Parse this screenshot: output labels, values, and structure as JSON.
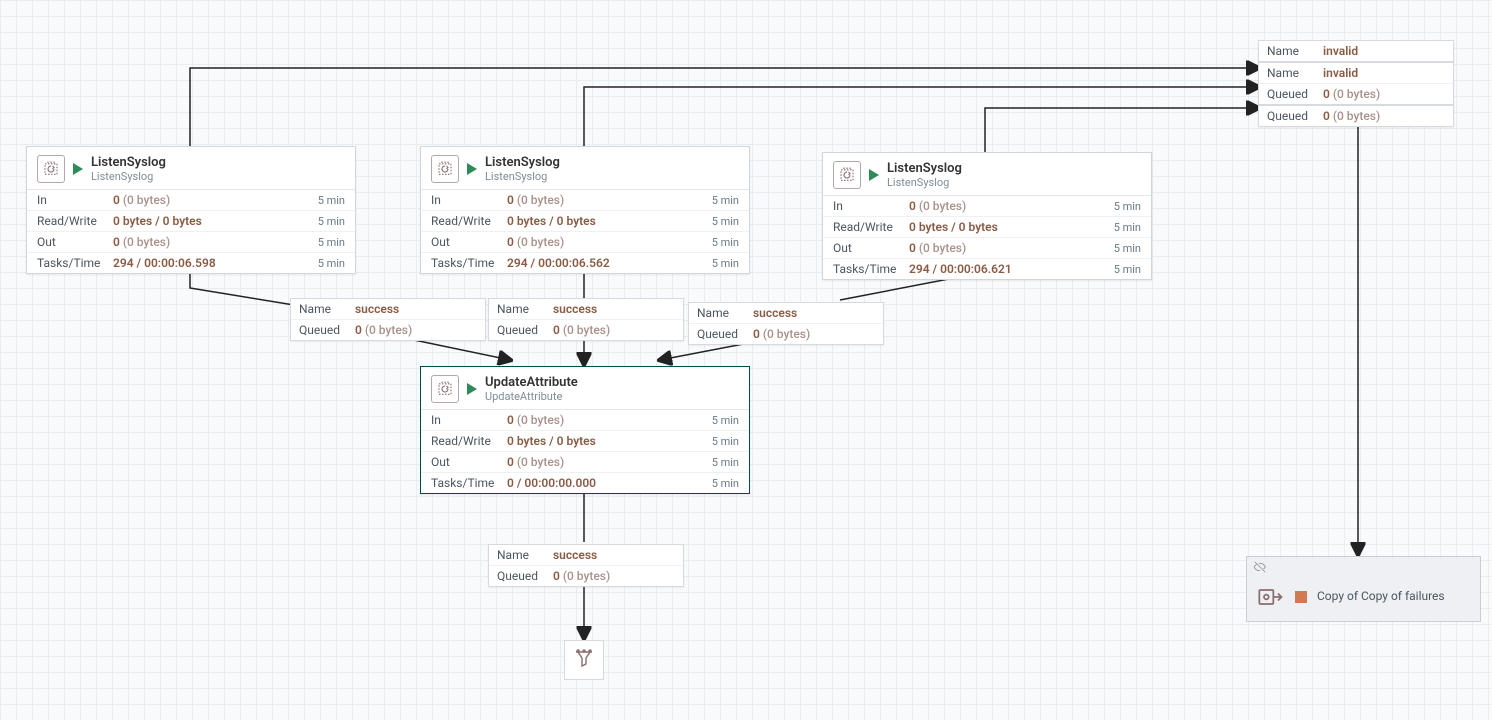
{
  "processors": [
    {
      "id": "p1",
      "title": "ListenSyslog",
      "subtitle": "ListenSyslog",
      "stats": {
        "in": {
          "count": "0",
          "bytes": "(0 bytes)",
          "time": "5 min"
        },
        "rw": {
          "value": "0 bytes / 0 bytes",
          "time": "5 min"
        },
        "out": {
          "count": "0",
          "bytes": "(0 bytes)",
          "time": "5 min"
        },
        "tasks": {
          "value": "294 / 00:00:06.598",
          "time": "5 min"
        }
      }
    },
    {
      "id": "p2",
      "title": "ListenSyslog",
      "subtitle": "ListenSyslog",
      "stats": {
        "in": {
          "count": "0",
          "bytes": "(0 bytes)",
          "time": "5 min"
        },
        "rw": {
          "value": "0 bytes / 0 bytes",
          "time": "5 min"
        },
        "out": {
          "count": "0",
          "bytes": "(0 bytes)",
          "time": "5 min"
        },
        "tasks": {
          "value": "294 / 00:00:06.562",
          "time": "5 min"
        }
      }
    },
    {
      "id": "p3",
      "title": "ListenSyslog",
      "subtitle": "ListenSyslog",
      "stats": {
        "in": {
          "count": "0",
          "bytes": "(0 bytes)",
          "time": "5 min"
        },
        "rw": {
          "value": "0 bytes / 0 bytes",
          "time": "5 min"
        },
        "out": {
          "count": "0",
          "bytes": "(0 bytes)",
          "time": "5 min"
        },
        "tasks": {
          "value": "294 / 00:00:06.621",
          "time": "5 min"
        }
      }
    },
    {
      "id": "p4",
      "title": "UpdateAttribute",
      "subtitle": "UpdateAttribute",
      "stats": {
        "in": {
          "count": "0",
          "bytes": "(0 bytes)",
          "time": "5 min"
        },
        "rw": {
          "value": "0 bytes / 0 bytes",
          "time": "5 min"
        },
        "out": {
          "count": "0",
          "bytes": "(0 bytes)",
          "time": "5 min"
        },
        "tasks": {
          "value": "0 / 00:00:00.000",
          "time": "5 min"
        }
      }
    }
  ],
  "labels": {
    "name": "Name",
    "queued": "Queued",
    "in": "In",
    "rw": "Read/Write",
    "out": "Out",
    "tasks": "Tasks/Time"
  },
  "connections": {
    "success": {
      "name": "success",
      "queued_count": "0",
      "queued_bytes": "(0 bytes)"
    },
    "invalid": {
      "name": "invalid",
      "queued_count": "0",
      "queued_bytes": "(0 bytes)"
    }
  },
  "group": {
    "title": "Copy of Copy of failures"
  }
}
